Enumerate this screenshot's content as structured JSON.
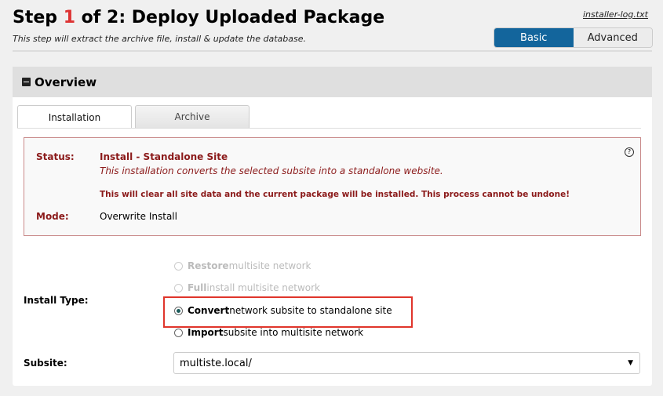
{
  "header": {
    "title_prefix": "Step ",
    "step": "1",
    "title_suffix": " of 2: Deploy Uploaded Package",
    "subtitle": "This step will extract the archive file, install & update the database.",
    "log_link": "installer-log.txt",
    "modes": [
      "Basic",
      "Advanced"
    ]
  },
  "panel": {
    "title": "Overview",
    "tabs": [
      "Installation",
      "Archive"
    ]
  },
  "status": {
    "status_label": "Status:",
    "status_value": "Install - Standalone Site",
    "description": "This installation converts the selected subsite into a standalone website.",
    "warning": "This will clear all site data and the current package will be installed. This process cannot be undone!",
    "mode_label": "Mode:",
    "mode_value": "Overwrite Install",
    "help": "?"
  },
  "install_type": {
    "label": "Install Type:",
    "options": [
      {
        "bold": "Restore",
        "rest": " multisite network"
      },
      {
        "bold": "Full",
        "rest": " install multisite network"
      },
      {
        "bold": "Convert",
        "rest": " network subsite to standalone site"
      },
      {
        "bold": "Import",
        "rest": " subsite into multisite network"
      }
    ]
  },
  "subsite": {
    "label": "Subsite:",
    "value": "multiste.local/",
    "arrow": "▼"
  }
}
